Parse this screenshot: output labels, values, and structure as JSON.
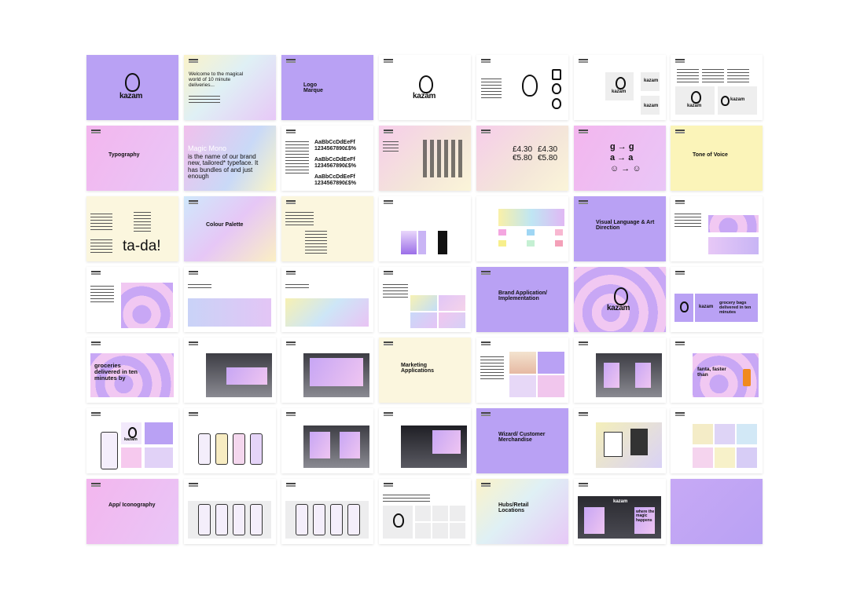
{
  "slides": {
    "s0": {
      "logo": "kazam"
    },
    "s1": {
      "headline": "Welcome to the magical world of 10 minute deliveries..."
    },
    "s2": {
      "title": "Logo Marque"
    },
    "s3": {
      "logo": "kazam"
    },
    "s6": {
      "logo_a": "kazam",
      "logo_b": "kazam",
      "logo_c": "kazam",
      "logo_d": "kazam"
    },
    "s5": {
      "logo_a": "kazam",
      "logo_b": "kazam",
      "logo_c": "kazam"
    },
    "s7": {
      "title": "Typography"
    },
    "s8": {
      "lead": "Magic Mono",
      "text": "is the name of our brand new, tailored* typeface. It has bundles of and just enough"
    },
    "s9": {
      "specimen_a": "AaBbCcDdEeFf",
      "digits_a": "1234567890£$%",
      "specimen_b": "AaBbCcDdEeFf",
      "digits_b": "1234567890£$%",
      "specimen_c": "AaBbCcDdEeFf",
      "digits_c": "1234567890£$%"
    },
    "s11": {
      "price1": "£4.30",
      "price2": "€5.80",
      "price3": "£4.30",
      "price4": "€5.80"
    },
    "s12": {
      "row1": "g → g",
      "row2": "a → a",
      "row3": "☺ → ☺"
    },
    "s13": {
      "title": "Tone of Voice"
    },
    "s14": {
      "word": "ta-da!"
    },
    "s15": {
      "title": "Colour Palette"
    },
    "s20": {
      "title": "Visual Language & Art Direction"
    },
    "s32": {
      "title": "Brand Application/ Implementation"
    },
    "s33": {
      "logo": "kazam"
    },
    "s34": {
      "tagline": "grocery bags delivered in ten minutes",
      "logo": "kazam"
    },
    "s35": {
      "headline": "groceries delivered in ten minutes by"
    },
    "s39": {
      "title": "Marketing Applications"
    },
    "s41": {
      "tagline": "fanta, faster than"
    },
    "s42": {
      "logo": "kazam"
    },
    "s46": {
      "title": "Wizard/ Customer Merchandise"
    },
    "s49": {
      "title": "App/ Iconography"
    },
    "s53": {
      "title": "Hubs/Retail Locations"
    },
    "s54": {
      "logo": "kazam",
      "tagline": "where the magic happens"
    }
  }
}
